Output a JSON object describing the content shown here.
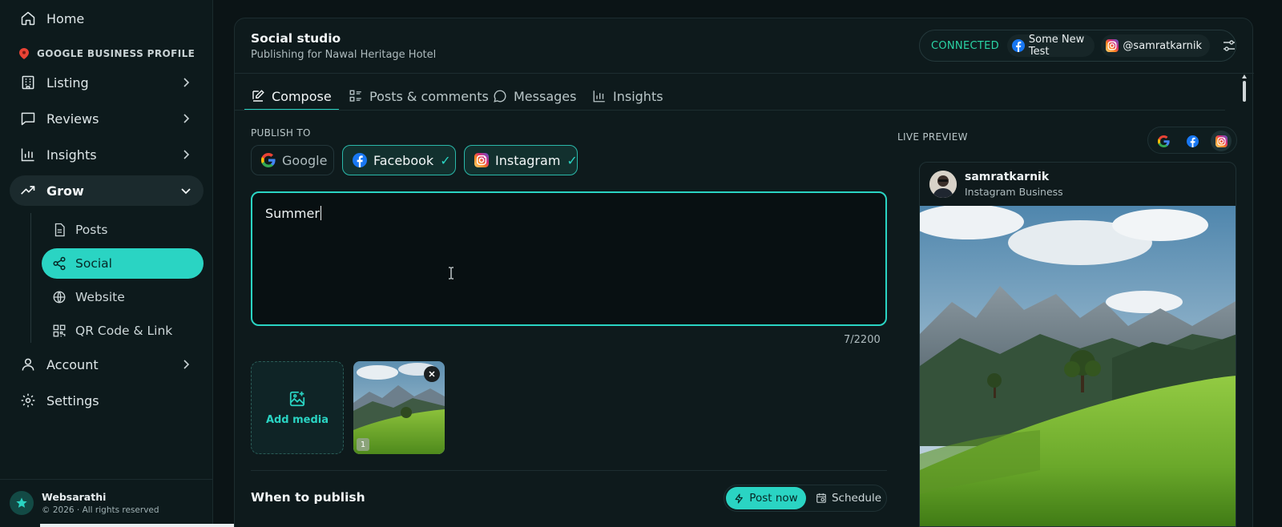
{
  "sidebar": {
    "home": "Home",
    "section_label": "GOOGLE BUSINESS PROFILE",
    "items": [
      {
        "label": "Listing"
      },
      {
        "label": "Reviews"
      },
      {
        "label": "Insights"
      },
      {
        "label": "Grow"
      }
    ],
    "sub_items": [
      {
        "label": "Posts"
      },
      {
        "label": "Social"
      },
      {
        "label": "Website"
      },
      {
        "label": "QR Code & Link"
      }
    ],
    "account": "Account",
    "settings": "Settings",
    "footer": {
      "brand": "Websarathi",
      "copyright": "© 2026 · All rights reserved"
    }
  },
  "header": {
    "title": "Social studio",
    "subtitle": "Publishing for Nawal Heritage Hotel",
    "connection": {
      "status": "CONNECTED",
      "facebook_account": "Some New Test",
      "instagram_account": "@samratkarnik"
    }
  },
  "tabs": [
    {
      "label": "Compose"
    },
    {
      "label": "Posts & comments"
    },
    {
      "label": "Messages"
    },
    {
      "label": "Insights"
    }
  ],
  "compose": {
    "publish_to_label": "PUBLISH TO",
    "channels": [
      {
        "label": "Google",
        "selected": false,
        "check": ""
      },
      {
        "label": "Facebook",
        "selected": true,
        "check": "✓"
      },
      {
        "label": "Instagram",
        "selected": true,
        "check": "✓"
      }
    ],
    "text": "Summer",
    "char_count": "7/2200",
    "add_media": "Add media",
    "media_index": "1",
    "when_label": "When to publish",
    "post_now": "Post now",
    "schedule": "Schedule"
  },
  "preview": {
    "label": "LIVE PREVIEW",
    "username": "samratkarnik",
    "account_type": "Instagram Business"
  },
  "colors": {
    "accent": "#2ad4c3",
    "background": "#0b1416",
    "card": "#0e1a1c"
  }
}
